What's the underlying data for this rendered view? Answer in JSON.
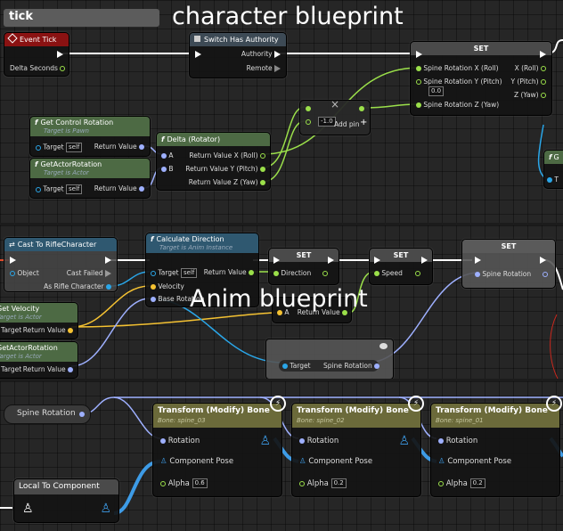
{
  "character_panel": {
    "tab_label": "tick",
    "caption": "character blueprint",
    "event_tick": {
      "title": "Event Tick",
      "delta_seconds": "Delta Seconds"
    },
    "switch_authority": {
      "title": "Switch Has Authority",
      "authority": "Authority",
      "remote": "Remote"
    },
    "set_node": {
      "title": "SET",
      "in_x": "Spine Rotation X (Roll)",
      "in_y": "Spine Rotation Y (Pitch)",
      "in_y_value": "0.0",
      "in_z": "Spine Rotation Z (Yaw)",
      "out_x": "X (Roll)",
      "out_y": "Y (Pitch)",
      "out_z": "Z (Yaw)"
    },
    "multiply_node": {
      "value": "-1.0",
      "add_pin": "Add pin"
    },
    "get_control_rotation": {
      "title": "Get Control Rotation",
      "subtitle": "Target is Pawn",
      "target": "Target",
      "self": "self",
      "return_value": "Return Value"
    },
    "get_actor_rotation": {
      "title": "GetActorRotation",
      "subtitle": "Target is Actor",
      "target": "Target",
      "self": "self",
      "return_value": "Return Value"
    },
    "delta_rotator": {
      "title": "Delta (Rotator)",
      "a": "A",
      "b": "B",
      "out_x": "Return Value X (Roll)",
      "out_y": "Return Value Y (Pitch)",
      "out_z": "Return Value Z (Yaw)"
    },
    "partial_node": {
      "title": "G",
      "pin": "T"
    }
  },
  "anim_panel": {
    "caption": "Anim blueprint",
    "cast_node": {
      "title": "Cast To RifleCharacter",
      "object": "Object",
      "cast_failed": "Cast Failed",
      "as_rifle": "As Rifle Character"
    },
    "calc_direction": {
      "title": "Calculate Direction",
      "subtitle": "Target is Anim Instance",
      "target": "Target",
      "self": "self",
      "velocity": "Velocity",
      "base_rotation": "Base Rotation",
      "return_value": "Return Value"
    },
    "set_direction": {
      "title": "SET",
      "pin": "Direction"
    },
    "set_speed": {
      "title": "SET",
      "pin": "Speed"
    },
    "set_spine": {
      "title": "SET",
      "pin": "Spine Rotation"
    },
    "vector_length": {
      "pin_a": "A",
      "return_value": "Return Value"
    },
    "get_velocity": {
      "title": "Get Velocity",
      "subtitle": "Target is Actor",
      "target": "Target",
      "return_value": "Return Value"
    },
    "get_actor_rotation": {
      "title": "GetActorRotation",
      "subtitle": "Target is Actor",
      "target": "Target",
      "return_value": "Return Value"
    },
    "spine_getter": {
      "target": "Target",
      "spine_rotation": "Spine Rotation"
    }
  },
  "anim_graph": {
    "spine_rotation_var": "Spine Rotation",
    "local_to_component": "Local To Component",
    "transforms": [
      {
        "title": "Transform (Modify) Bone",
        "bone": "Bone: spine_03",
        "rotation": "Rotation",
        "component_pose": "Component Pose",
        "alpha": "Alpha",
        "alpha_value": "0.6"
      },
      {
        "title": "Transform (Modify) Bone",
        "bone": "Bone: spine_02",
        "rotation": "Rotation",
        "component_pose": "Component Pose",
        "alpha": "Alpha",
        "alpha_value": "0.2"
      },
      {
        "title": "Transform (Modify) Bone",
        "bone": "Bone: spine_01",
        "rotation": "Rotation",
        "component_pose": "Component Pose",
        "alpha": "Alpha",
        "alpha_value": "0.2"
      }
    ]
  },
  "colors": {
    "exec": "#ffffff",
    "rotator": "#9eb0ff",
    "float": "#9be04a",
    "vector": "#f5c232",
    "object": "#2aa6e8",
    "pose": "#3d9be6"
  },
  "icons": [
    "event-icon",
    "function-icon",
    "pose-person-icon",
    "lightning-icon",
    "exec-pin-icon"
  ]
}
